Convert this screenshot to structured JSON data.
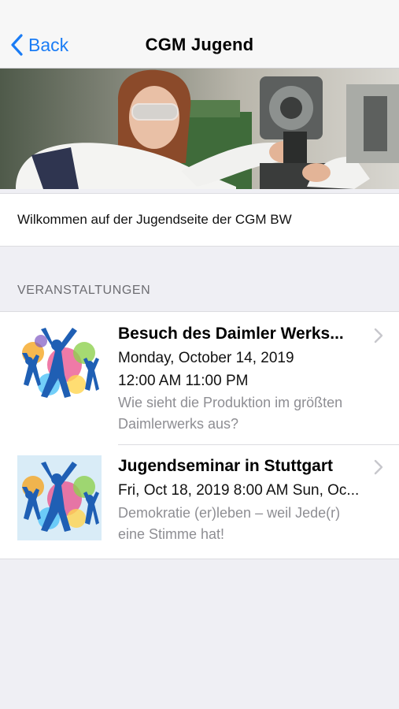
{
  "nav": {
    "back_label": "Back",
    "title": "CGM Jugend"
  },
  "welcome_text": "Wilkommen auf der Jugendseite der CGM BW",
  "section_header": "VERANSTALTUNGEN",
  "events": [
    {
      "title": "Besuch des Daimler Werks...",
      "date": "Monday, October 14, 2019",
      "time": "12:00 AM 11:00 PM",
      "desc1": "Wie sieht die Produktion im größten",
      "desc2": "Daimlerwerks aus?"
    },
    {
      "title": "Jugendseminar in Stuttgart",
      "date": "Fri, Oct 18, 2019 8:00 AM Sun, Oc...",
      "desc1": "Demokratie (er)leben – weil Jede(r)",
      "desc2": "eine Stimme hat!"
    }
  ],
  "colors": {
    "accent": "#1a7cf5",
    "background": "#efeff4",
    "secondary_text": "#8e8e93"
  }
}
